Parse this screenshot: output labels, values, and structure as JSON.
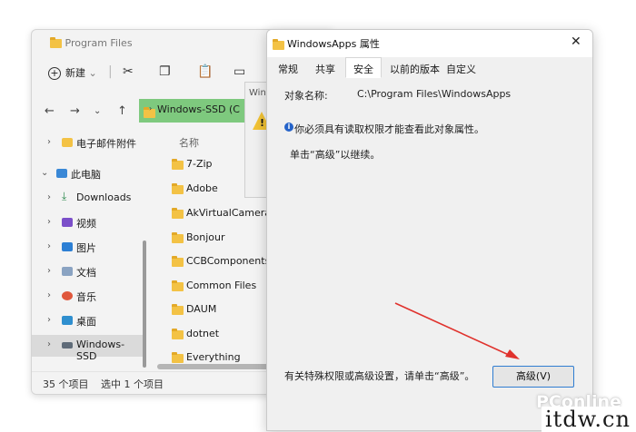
{
  "explorer": {
    "title": "Program Files",
    "new_label": "新建",
    "address": "Windows-SSD (C",
    "column_name": "名称",
    "sidebar": [
      {
        "label": "电子邮件附件",
        "icon": "folder-icon",
        "chevron": "›"
      },
      {
        "label": "此电脑",
        "icon": "computer-icon",
        "chevron": "⌄"
      },
      {
        "label": "Downloads",
        "icon": "download-icon",
        "chevron": "›"
      },
      {
        "label": "视频",
        "icon": "video-icon",
        "chevron": "›"
      },
      {
        "label": "图片",
        "icon": "picture-icon",
        "chevron": "›"
      },
      {
        "label": "文档",
        "icon": "document-icon",
        "chevron": "›"
      },
      {
        "label": "音乐",
        "icon": "music-icon",
        "chevron": "›"
      },
      {
        "label": "桌面",
        "icon": "desktop-icon",
        "chevron": "›"
      },
      {
        "label": "Windows-SSD",
        "icon": "drive-icon",
        "chevron": "›"
      }
    ],
    "files": [
      "7-Zip",
      "Adobe",
      "AkVirtualCamera.p",
      "Bonjour",
      "CCBComponents",
      "Common Files",
      "DAUM",
      "dotnet",
      "Everything"
    ],
    "status_count": "35 个项目",
    "status_selected": "选中 1 个项目"
  },
  "mini_dialog": {
    "title": "Win",
    "warn": "!"
  },
  "properties": {
    "title": "WindowsApps 属性",
    "close": "✕",
    "tabs": [
      "常规",
      "共享",
      "安全",
      "以前的版本",
      "自定义"
    ],
    "object_label": "对象名称:",
    "object_value": "C:\\Program Files\\WindowsApps",
    "info_text": "你必须具有读取权限才能查看此对象属性。",
    "continue_text": "单击“高级”以继续。",
    "advanced_note": "有关特殊权限或高级设置，请单击“高级”。",
    "advanced_button": "高级(V)"
  },
  "watermark": {
    "brand": "PConline",
    "site": "itdw.cn"
  },
  "colors": {
    "address_bar": "#7ec97e",
    "annotation_arrow": "#e0322d",
    "accent": "#2f7dd1"
  }
}
